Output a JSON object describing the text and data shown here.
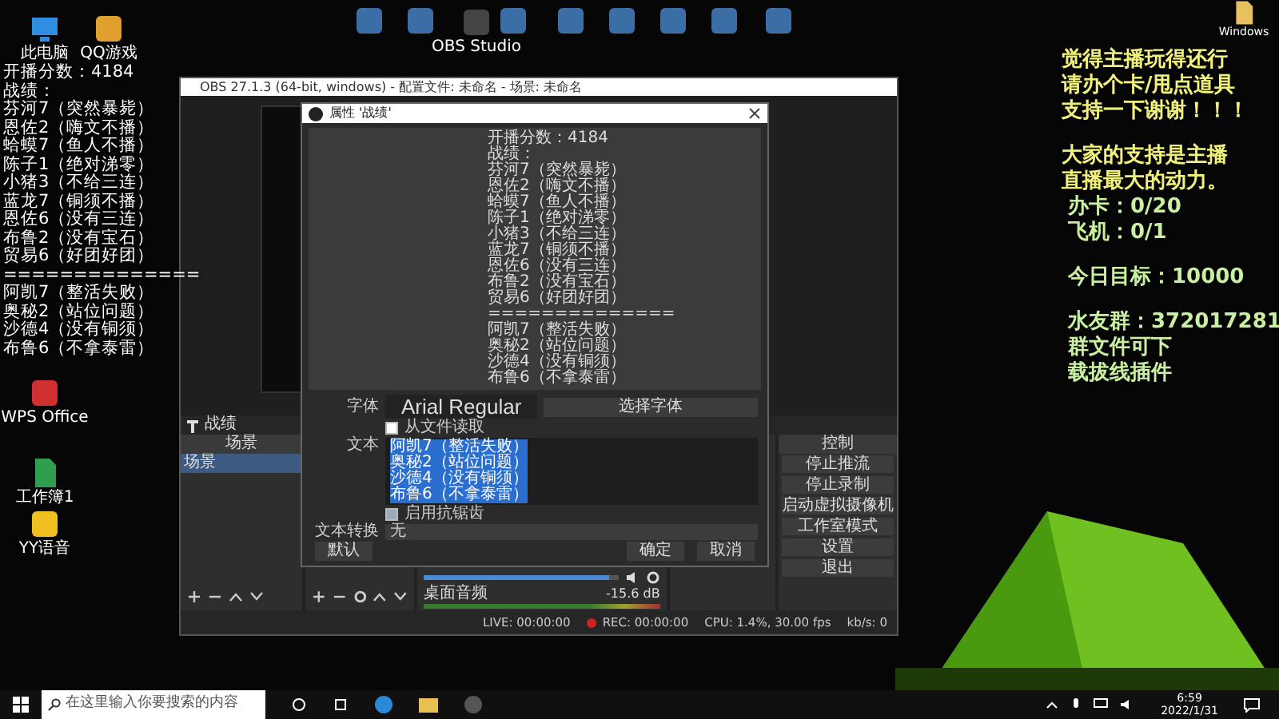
{
  "desktop_icons": [
    {
      "label": "此电脑",
      "kind": "pc",
      "color": "#2f8ee0"
    },
    {
      "label": "QQ游戏",
      "kind": "app",
      "color": "#e0a030"
    },
    {
      "label": "OBS Studio",
      "kind": "app",
      "color": "#444444"
    },
    {
      "label": "Windows",
      "kind": "file",
      "color": "#e8c060"
    },
    {
      "label": "WPS Office",
      "kind": "app",
      "color": "#d03030"
    },
    {
      "label": "工作簿1",
      "kind": "file",
      "color": "#2f9e4f"
    },
    {
      "label": "YY语音",
      "kind": "app",
      "color": "#f0c020"
    }
  ],
  "score_overlay": {
    "lines": [
      "开播分数：4184",
      "战绩：",
      "芬河7（突然暴毙）",
      "恩佐2（嗨文不播）",
      "蛤蟆7（鱼人不播）",
      "陈子1（绝对涕零）",
      "小猪3（不给三连）",
      "蓝龙7（铜须不播）",
      "恩佐6（没有三连）",
      "布鲁2（没有宝石）",
      "贸易6（好团好团）",
      "==============",
      "阿凯7（整活失败）",
      "奥秘2（站位问题）",
      "沙德4（没有铜须）",
      "布鲁6（不拿泰雷）"
    ]
  },
  "support_overlay": {
    "paragraphs": [
      {
        "lines": [
          {
            "text": "觉得主播玩得还行",
            "kind": "yellow"
          },
          {
            "text": "请办个卡/甩点道具",
            "kind": "yellow"
          },
          {
            "text": "支持一下谢谢！！！",
            "kind": "yellow"
          }
        ]
      },
      {
        "lines": [
          {
            "text": "大家的支持是主播",
            "kind": "yellow"
          },
          {
            "text": "直播最大的动力。",
            "kind": "yellow"
          },
          {
            "text": "办卡：0/20",
            "kind": "green"
          },
          {
            "text": "飞机：0/1",
            "kind": "green"
          }
        ]
      },
      {
        "lines": [
          {
            "text": "今日目标：10000",
            "kind": "green"
          }
        ]
      },
      {
        "lines": [
          {
            "text": "水友群：372017281",
            "kind": "green"
          },
          {
            "text": "群文件可下",
            "kind": "green"
          },
          {
            "text": "载拔线插件",
            "kind": "green"
          }
        ]
      }
    ]
  },
  "obs_window": {
    "title": "OBS 27.1.3 (64-bit, windows) - 配置文件: 未命名 - 场景: 未命名",
    "source_name": "战绩",
    "scenes": {
      "title": "场景",
      "items": [
        {
          "label": "场景",
          "selected": true
        }
      ]
    },
    "mixer": {
      "source": "桌面音频",
      "reading": "-15.6 dB",
      "level": 0.95
    },
    "controls": {
      "title": "控制",
      "buttons": [
        "停止推流",
        "停止录制",
        "启动虚拟摄像机",
        "工作室模式",
        "设置",
        "退出"
      ]
    },
    "status_bar": {
      "live": "LIVE: 00:00:00",
      "rec": "REC: 00:00:00",
      "cpu": "CPU: 1.4%, 30.00 fps",
      "kbps": "kb/s: 0"
    }
  },
  "properties_dialog": {
    "title": "属性 '战绩'",
    "preview_lines": [
      "开播分数：4184",
      "战绩：",
      "芬河7（突然暴毙）",
      "恩佐2（嗨文不播）",
      "蛤蟆7（鱼人不播）",
      "陈子1（绝对涕零）",
      "小猪3（不给三连）",
      "蓝龙7（铜须不播）",
      "恩佐6（没有三连）",
      "布鲁2（没有宝石）",
      "贸易6（好团好团）",
      "==============",
      "阿凯7（整活失败）",
      "奥秘2（站位问题）",
      "沙德4（没有铜须）",
      "布鲁6（不拿泰雷）"
    ],
    "font_label": "字体",
    "font_value": "Arial Regular",
    "font_button": "选择字体",
    "read_from_file": {
      "label": "从文件读取",
      "checked": false
    },
    "text_label": "文本",
    "text_lines": [
      "阿凯7（整活失败）",
      "奥秘2（站位问题）",
      "沙德4（没有铜须）",
      "布鲁6（不拿泰雷）"
    ],
    "antialias": {
      "label": "启用抗锯齿",
      "checked": true
    },
    "transform_label": "文本转换",
    "transform_value": "无",
    "buttons": [
      {
        "label": "默认",
        "kind": "left"
      },
      {
        "label": "确定",
        "kind": "right"
      },
      {
        "label": "取消",
        "kind": "right"
      }
    ]
  },
  "taskbar": {
    "search_placeholder": "在这里输入你要搜索的内容",
    "time": "6:59",
    "date": "2022/1/31"
  }
}
